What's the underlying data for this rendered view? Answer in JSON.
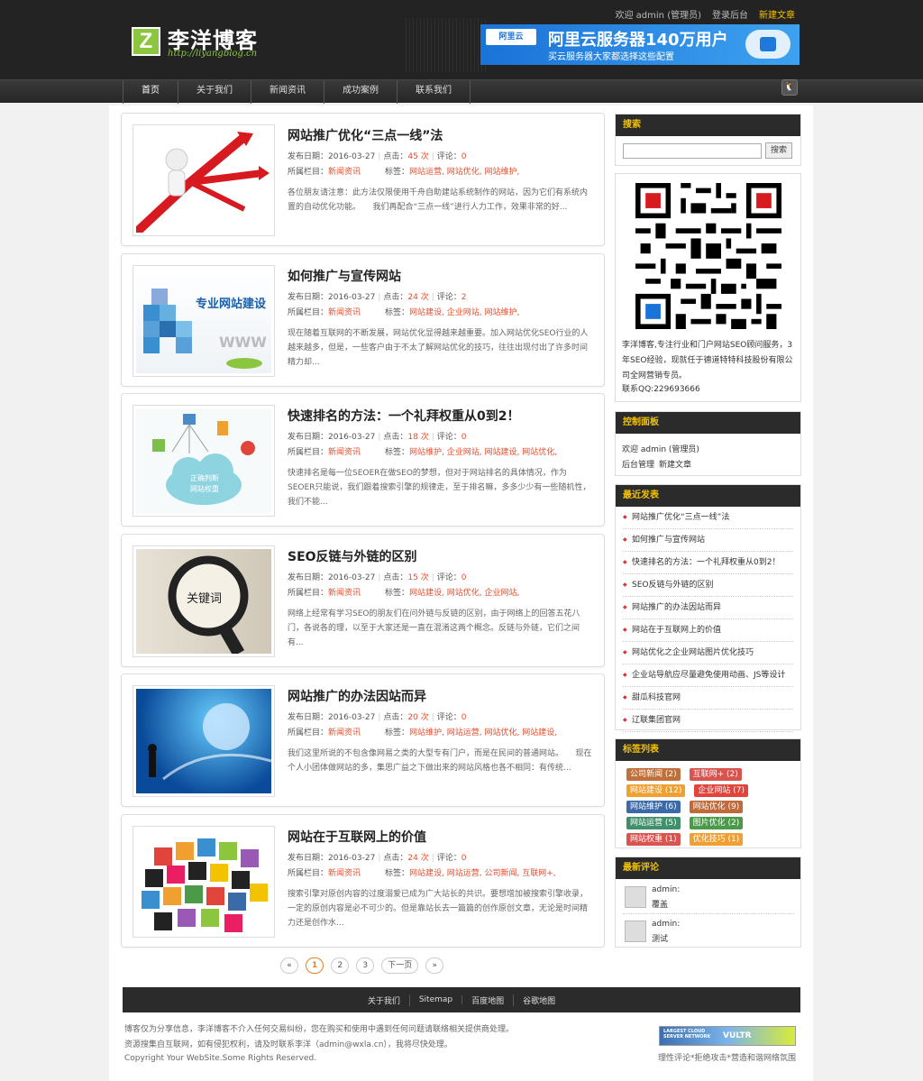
{
  "header": {
    "logo_letter": "Z",
    "site_title": "李洋博客",
    "site_url": "http://liyangblog.cn",
    "welcome": "欢迎 admin (管理员)",
    "login_backend": "登录后台",
    "new_post": "新建文章"
  },
  "ad": {
    "brand": "阿里云",
    "headline": "阿里云服务器140万用户",
    "subline": "买云服务器大家都选择这些配置"
  },
  "nav": [
    "首页",
    "关于我们",
    "新闻资讯",
    "成功案例",
    "联系我们"
  ],
  "posts": [
    {
      "title": "网站推广优化“三点一线”法",
      "date": "发布日期：2016-03-27",
      "views_label": "点击：",
      "views": "45 次",
      "comments_label": "评论：",
      "comments": "0",
      "cat_label": "所属栏目：",
      "cat": "新闻资讯",
      "tags_label": "标签：",
      "tags": "网站运营, 网站优化, 网站维护,",
      "excerpt": "各位朋友请注意：此方法仅限使用千舟自助建站系统制作的网站，因为它们有系统内置的自动优化功能。　　我们再配合“三点一线”进行人力工作，效果非常的好..."
    },
    {
      "title": "如何推广与宣传网站",
      "date": "发布日期：2016-03-27",
      "views_label": "点击：",
      "views": "24 次",
      "comments_label": "评论：",
      "comments": "2",
      "cat_label": "所属栏目：",
      "cat": "新闻资讯",
      "tags_label": "标签：",
      "tags": "网站建设, 企业网站, 网站维护,",
      "excerpt": "现在随着互联网的不断发展，网站优化显得越来越重要。加入网站优化SEO行业的人越来越多，但是，一些客户由于不太了解网站优化的技巧，往往出现付出了许多时间精力却..."
    },
    {
      "title": "快速排名的方法：一个礼拜权重从0到2！",
      "date": "发布日期：2016-03-27",
      "views_label": "点击：",
      "views": "18 次",
      "comments_label": "评论：",
      "comments": "0",
      "cat_label": "所属栏目：",
      "cat": "新闻资讯",
      "tags_label": "标签：",
      "tags": "网站维护, 企业网站, 网站建设, 网站优化,",
      "excerpt": "快速排名是每一位SEOER在做SEO的梦想，但对于网站排名的具体情况，作为SEOER只能说，我们跟着搜索引擎的规律走，至于排名嘛，多多少少有一些随机性，我们不能..."
    },
    {
      "title": "SEO反链与外链的区别",
      "date": "发布日期：2016-03-27",
      "views_label": "点击：",
      "views": "15 次",
      "comments_label": "评论：",
      "comments": "0",
      "cat_label": "所属栏目：",
      "cat": "新闻资讯",
      "tags_label": "标签：",
      "tags": "网站建设, 网站优化, 企业网站,",
      "excerpt": "网络上经常有学习SEO的朋友们在问外链与反链的区别，由于网络上的回答五花八门，各说各的理，以至于大家还是一直在混淆这两个概念。反链与外链，它们之间有..."
    },
    {
      "title": "网站推广的办法因站而异",
      "date": "发布日期：2016-03-27",
      "views_label": "点击：",
      "views": "20 次",
      "comments_label": "评论：",
      "comments": "0",
      "cat_label": "所属栏目：",
      "cat": "新闻资讯",
      "tags_label": "标签：",
      "tags": "网站维护, 网站运营, 网站优化, 网站建设,",
      "excerpt": "我们这里所说的不包含像网易之类的大型专有门户，而是在民间的普通网站。　　现在个人小团体做网站的多，集思广益之下做出来的网站风格也各不相同：有传统..."
    },
    {
      "title": "网站在于互联网上的价值",
      "date": "发布日期：2016-03-27",
      "views_label": "点击：",
      "views": "24 次",
      "comments_label": "评论：",
      "comments": "0",
      "cat_label": "所属栏目：",
      "cat": "新闻资讯",
      "tags_label": "标签：",
      "tags": "网站建设, 网站运营, 公司新闻, 互联网+,",
      "excerpt": "搜索引擎对原创内容的过度溺爱已成为广大站长的共识。要想增加被搜索引擎收录，一定的原创内容是必不可少的。但是靠站长去一篇篇的创作原创文章，无论是时间精力还是创作水..."
    }
  ],
  "thumb_texts": {
    "p2_title": "专业网站建设",
    "p2_sub": "WWW",
    "p3_cloud": "正确判断\n网站权重",
    "p4_lens": "关键词"
  },
  "sidebar": {
    "search_title": "搜索",
    "search_placeholder": "",
    "search_button": "搜索",
    "about_text": "李洋博客,专注行业和门户网站SEO顾问服务，3年SEO经验，现就任于德道特特科技股份有限公司全网营销专员。",
    "about_qq": "联系QQ:229693666",
    "control_title": "控制面板",
    "control_welcome": "欢迎 admin (管理员)",
    "control_backend": "后台管理",
    "control_new": "新建文章",
    "recent_title": "最近发表",
    "recent": [
      "网站推广优化“三点一线”法",
      "如何推广与宣传网站",
      "快速排名的方法：一个礼拜权重从0到2！",
      "SEO反链与外链的区别",
      "网站推广的办法因站而异",
      "网站在于互联网上的价值",
      "网站优化之企业网站图片优化技巧",
      "企业站导航应尽量避免使用动画、JS等设计",
      "甜瓜科技官网",
      "辽联集团官网"
    ],
    "tags_title": "标签列表",
    "tags": [
      {
        "label": "公司新闻 (2)",
        "color": "#c0703a"
      },
      {
        "label": "互联网+ (2)",
        "color": "#d9534f"
      },
      {
        "label": "网站建设 (12)",
        "color": "#f0a030"
      },
      {
        "label": "企业网站 (7)",
        "color": "#e0443a"
      },
      {
        "label": "网站维护 (6)",
        "color": "#3a6aa8"
      },
      {
        "label": "网站优化 (9)",
        "color": "#c06a3a"
      },
      {
        "label": "网站运营 (5)",
        "color": "#3f8f6a"
      },
      {
        "label": "图片优化 (2)",
        "color": "#4a9a4a"
      },
      {
        "label": "网站权重 (1)",
        "color": "#d9534f"
      },
      {
        "label": "优化技巧 (1)",
        "color": "#f0a030"
      }
    ],
    "comments_title": "最新评论",
    "comments": [
      {
        "author": "admin:",
        "text": "覆盖"
      },
      {
        "author": "admin:",
        "text": "测试"
      }
    ]
  },
  "pager": [
    "«",
    "1",
    "2",
    "3",
    "下一页",
    "»"
  ],
  "footer": {
    "links": [
      "关于我们",
      "Sitemap",
      "百度地图",
      "谷歌地图"
    ],
    "line1": "博客仅为分享信息，李洋博客不介入任何交易纠纷，您在购买和使用中遇到任何问题请联络相关提供商处理。",
    "line2": "资源搜集自互联网，如有侵犯权利，请及时联系李洋（admin@wxla.cn），我将尽快处理。",
    "line3": "Copyright Your WebSite.Some Rights Reserved.",
    "badge_text": "理性评论*拒绝攻击*营造和谐网络氛围",
    "badge_label1": "LARGEST CLOUD SERVER NETWORK",
    "badge_label2": "VULTR"
  }
}
